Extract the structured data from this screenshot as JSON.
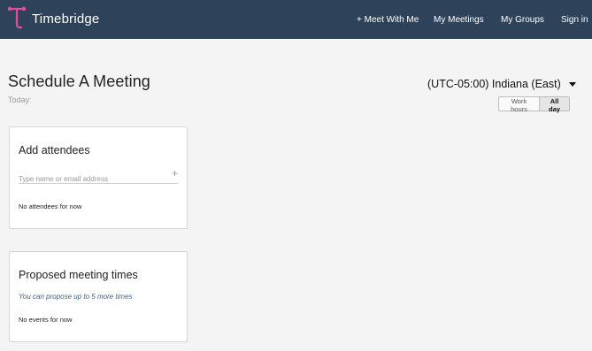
{
  "brand": {
    "name": "Timebridge",
    "logo_color": "#e94b9b"
  },
  "nav": {
    "meet_with_me": "+ Meet With Me",
    "my_meetings": "My Meetings",
    "my_groups": "My Groups",
    "sign_in": "Sign in"
  },
  "page": {
    "title": "Schedule A Meeting",
    "today": "Today:"
  },
  "timezone": {
    "label": "(UTC-05:00) Indiana (East)"
  },
  "hours_toggle": {
    "work_hours": "Work hours",
    "all_day": "All day",
    "selected": "All day"
  },
  "attendees": {
    "heading": "Add attendees",
    "placeholder": "Type name or email address",
    "add_symbol": "+",
    "empty": "No attendees for now"
  },
  "proposed": {
    "heading": "Proposed meeting times",
    "note": "You can propose up to 5 more times",
    "empty": "No events for now"
  },
  "colors": {
    "topbar": "#2e4359",
    "link": "#3f5f86"
  }
}
